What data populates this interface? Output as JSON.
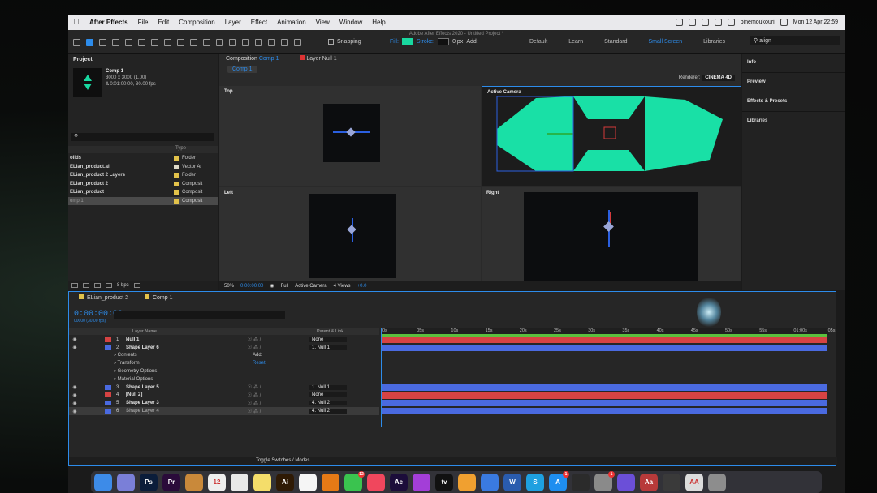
{
  "menubar": {
    "app": "After Effects",
    "items": [
      "File",
      "Edit",
      "Composition",
      "Layer",
      "Effect",
      "Animation",
      "View",
      "Window",
      "Help"
    ],
    "user": "binemoukouri",
    "clock": "Mon 12 Apr 22:59"
  },
  "toolbar": {
    "doc_title": "Adobe After Effects 2020 - Untitled Project *",
    "snapping": "Snapping",
    "fill_label": "Fill:",
    "stroke_label": "Stroke:",
    "stroke_px": "0 px",
    "add_label": "Add:",
    "workspaces": [
      "Default",
      "Learn",
      "Standard",
      "Small Screen",
      "Libraries"
    ],
    "active_workspace": "Small Screen",
    "search_value": "align",
    "fill_color": "#19d8a0",
    "accent_color": "#2d8ceb"
  },
  "project": {
    "tab": "Project",
    "comp_name": "Comp 1",
    "comp_size": "3000 x 3000 (1.00)",
    "comp_duration": "Δ 0:01:00:00, 30.00 fps",
    "column_type": "Type",
    "bpc": "8 bpc",
    "items": [
      {
        "name": "olids",
        "type": "Folder",
        "color": "#e2c24a"
      },
      {
        "name": "ELian_product.ai",
        "type": "Vector Ar",
        "color": "#ddd9c8"
      },
      {
        "name": "ELian_product 2 Layers",
        "type": "Folder",
        "color": "#e2c24a"
      },
      {
        "name": "ELian_product 2",
        "type": "Composit",
        "color": "#e2c24a"
      },
      {
        "name": "ELian_product",
        "type": "Composit",
        "color": "#e2c24a"
      },
      {
        "name": "omp 1",
        "type": "Composit",
        "color": "#e2c24a"
      }
    ]
  },
  "composition": {
    "tab_prefix": "Composition",
    "tab_comp": "Comp 1",
    "layer_tab": "Layer Null 1",
    "comp_pill": "Comp 1",
    "renderer_label": "Renderer:",
    "renderer_value": "CINEMA 4D",
    "views": {
      "top": "Top",
      "active": "Active Camera",
      "left": "Left",
      "right": "Right"
    },
    "footer": {
      "zoom": "50%",
      "timecode": "0:00:00:00",
      "resolution": "Full",
      "camera": "Active Camera",
      "views": "4 Views",
      "exposure": "+0.0"
    }
  },
  "right_panels": [
    "Info",
    "Preview",
    "Effects & Presets",
    "Libraries"
  ],
  "timeline": {
    "tabs": [
      "ELian_product 2",
      "Comp 1"
    ],
    "timecode": "0:00:00:00",
    "fps_sub": "00000 (30.00 fps)",
    "col_layer_name": "Layer Name",
    "col_parent": "Parent & Link",
    "ruler_ticks": [
      "0s",
      "05s",
      "10s",
      "15s",
      "20s",
      "25s",
      "30s",
      "35s",
      "40s",
      "45s",
      "50s",
      "55s",
      "01:00s",
      "05s"
    ],
    "layers": [
      {
        "num": "1",
        "name": "Null 1",
        "parent": "None",
        "color": "#d64343",
        "bar": "#d64343",
        "kind": "layer"
      },
      {
        "num": "2",
        "name": "Shape Layer 6",
        "parent": "1. Null 1",
        "color": "#4a6ae0",
        "bar": "#4a6ae0",
        "kind": "layer"
      },
      {
        "name": "Contents",
        "extra": "Add:",
        "kind": "prop"
      },
      {
        "name": "Transform",
        "extra": "Reset",
        "kind": "prop"
      },
      {
        "name": "Geometry Options",
        "kind": "prop"
      },
      {
        "name": "Material Options",
        "kind": "prop"
      },
      {
        "num": "3",
        "name": "Shape Layer 5",
        "parent": "1. Null 1",
        "color": "#4a6ae0",
        "bar": "#4a6ae0",
        "kind": "layer"
      },
      {
        "num": "4",
        "name": "[Null 2]",
        "parent": "None",
        "color": "#d64343",
        "bar": "#d64343",
        "kind": "layer"
      },
      {
        "num": "5",
        "name": "Shape Layer 3",
        "parent": "4. Null 2",
        "color": "#4a6ae0",
        "bar": "#4a6ae0",
        "kind": "layer"
      },
      {
        "num": "6",
        "name": "Shape Layer 4",
        "parent": "4. Null 2",
        "color": "#4a6ae0",
        "bar": "#4a6ae0",
        "kind": "layer",
        "selected": true
      }
    ],
    "footer_toggle": "Toggle Switches / Modes"
  },
  "dock": [
    {
      "name": "Finder",
      "label": "",
      "color": "#3d8be8"
    },
    {
      "name": "Launchpad",
      "label": "",
      "color": "#7a7fd8"
    },
    {
      "name": "Photoshop",
      "label": "Ps",
      "color": "#0b1d3a"
    },
    {
      "name": "Premiere",
      "label": "Pr",
      "color": "#2a0b3a"
    },
    {
      "name": "Contacts",
      "label": "",
      "color": "#c9893a"
    },
    {
      "name": "Calendar",
      "label": "12",
      "color": "#eeeeee"
    },
    {
      "name": "Chrome",
      "label": "",
      "color": "#e8e8e8"
    },
    {
      "name": "Notes",
      "label": "",
      "color": "#f4dd6a"
    },
    {
      "name": "Illustrator",
      "label": "Ai",
      "color": "#2f1a05"
    },
    {
      "name": "Reminders",
      "label": "",
      "color": "#f5f5f5"
    },
    {
      "name": "VLC",
      "label": "",
      "color": "#e67a16"
    },
    {
      "name": "Messages",
      "label": "",
      "color": "#3ac34f",
      "badge": "12"
    },
    {
      "name": "Music",
      "label": "",
      "color": "#f0475d"
    },
    {
      "name": "After Effects",
      "label": "Ae",
      "color": "#1c0d3a"
    },
    {
      "name": "Podcasts",
      "label": "",
      "color": "#a33ed8"
    },
    {
      "name": "Apple TV",
      "label": "tv",
      "color": "#111111"
    },
    {
      "name": "Sublime",
      "label": "",
      "color": "#f0a030"
    },
    {
      "name": "Keynote",
      "label": "",
      "color": "#3a7ae0"
    },
    {
      "name": "Word",
      "label": "W",
      "color": "#2a5cae"
    },
    {
      "name": "Skype",
      "label": "S",
      "color": "#1ea0e0"
    },
    {
      "name": "App Store",
      "label": "A",
      "color": "#1e8ef0",
      "badge": "1"
    },
    {
      "name": "Figma",
      "label": "",
      "color": "#2b2b2b"
    },
    {
      "name": "System Preferences",
      "label": "",
      "color": "#8a8a8a",
      "badge": "1"
    },
    {
      "name": "Siri",
      "label": "",
      "color": "#6b4fd8"
    },
    {
      "name": "Dictionary",
      "label": "Aa",
      "color": "#b83a3a"
    },
    {
      "name": "Figma 2",
      "label": "",
      "color": "#3a3a3a"
    },
    {
      "name": "Font Book",
      "label": "AA",
      "color": "#dcdcdc"
    },
    {
      "name": "Trash",
      "label": "",
      "color": "#8d8d8d"
    }
  ]
}
